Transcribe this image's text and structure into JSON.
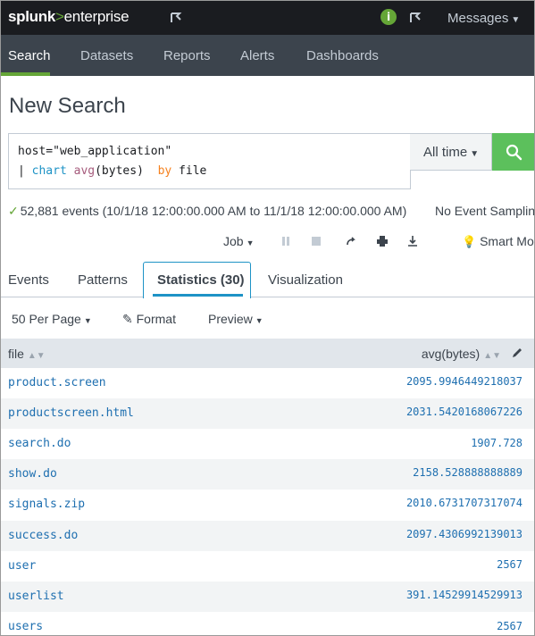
{
  "app": {
    "logo_main": "splunk",
    "logo_accent": ">",
    "logo_suffix": "enterprise",
    "health_symbol": "i",
    "messages_label": "Messages",
    "brand_color": "#65a637"
  },
  "nav": {
    "items": [
      "Search",
      "Datasets",
      "Reports",
      "Alerts",
      "Dashboards"
    ],
    "active": "Search"
  },
  "page": {
    "title": "New Search"
  },
  "search": {
    "line1": "host=\"web_application\"",
    "line2_pipe": "|",
    "line2_cmd": "chart",
    "line2_fn": "avg",
    "line2_args": "(bytes)",
    "line2_by": "by",
    "line2_field": "file",
    "time_range": "All time",
    "submit_icon": "search-icon"
  },
  "status": {
    "events": "52,881 events (10/1/18 12:00:00.000 AM to 11/1/18 12:00:00.000 AM)",
    "sampling": "No Event Sampling"
  },
  "job": {
    "job_label": "Job",
    "smart_mode": "Smart Mode"
  },
  "tabs": {
    "events": "Events",
    "patterns": "Patterns",
    "statistics": "Statistics (30)",
    "visualization": "Visualization"
  },
  "toolbar": {
    "per_page": "50 Per Page",
    "format": "Format",
    "preview": "Preview"
  },
  "table": {
    "columns": [
      "file",
      "avg(bytes)"
    ],
    "rows": [
      {
        "file": "product.screen",
        "avg": "2095.9946449218037"
      },
      {
        "file": "productscreen.html",
        "avg": "2031.5420168067226"
      },
      {
        "file": "search.do",
        "avg": "1907.728"
      },
      {
        "file": "show.do",
        "avg": "2158.528888888889"
      },
      {
        "file": "signals.zip",
        "avg": "2010.6731707317074"
      },
      {
        "file": "success.do",
        "avg": "2097.4306992139013"
      },
      {
        "file": "user",
        "avg": "2567"
      },
      {
        "file": "userlist",
        "avg": "391.14529914529913"
      },
      {
        "file": "users",
        "avg": "2567"
      }
    ]
  }
}
